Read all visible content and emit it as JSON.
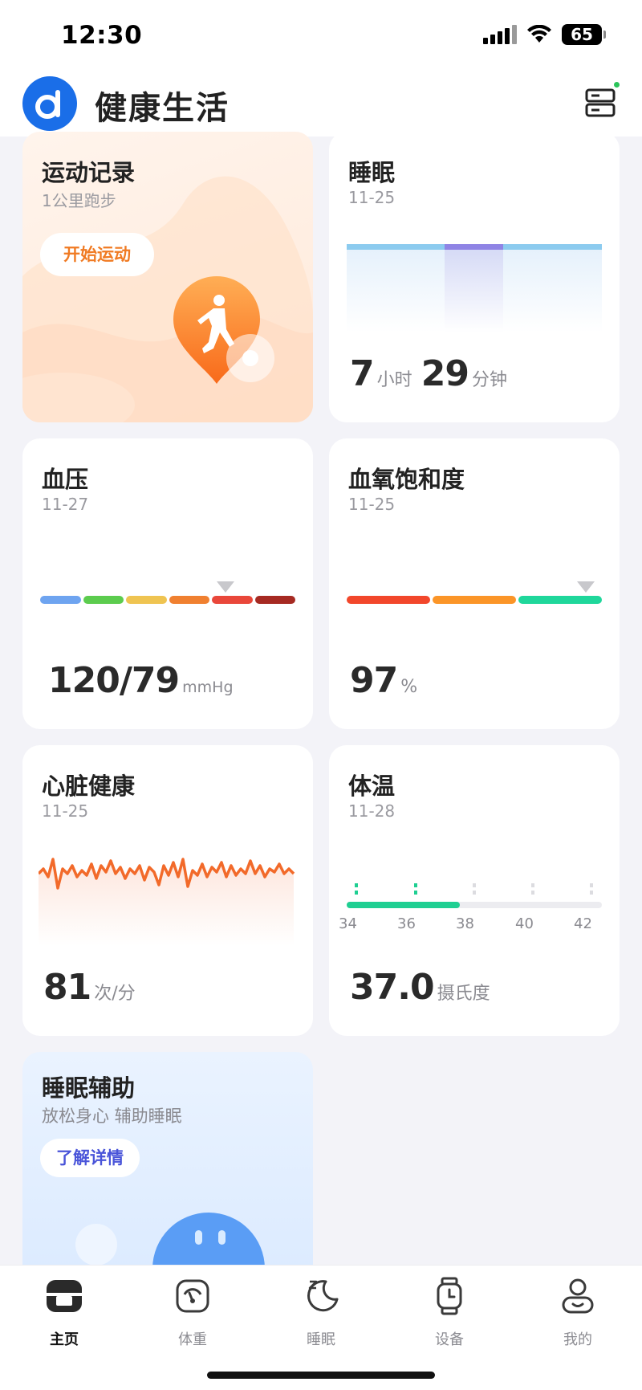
{
  "status_bar": {
    "time": "12:30",
    "battery": "65"
  },
  "header": {
    "title": "健康生活",
    "device_icon": "device-list-icon",
    "logo_icon": "app-logo-d"
  },
  "cards": {
    "exercise": {
      "title": "运动记录",
      "subtitle": "1公里跑步",
      "button": "开始运动",
      "icon": "runner-pin-icon"
    },
    "sleep": {
      "title": "睡眠",
      "date": "11-25",
      "hours": "7",
      "hours_unit": "小时",
      "minutes": "29",
      "minutes_unit": "分钟"
    },
    "blood_pressure": {
      "title": "血压",
      "date": "11-27",
      "value": "120/79",
      "unit": "mmHg",
      "scale_colors": [
        "#6ea4f0",
        "#5ccc4e",
        "#efc451",
        "#f08030",
        "#e9473a",
        "#a62a22"
      ],
      "level_index": 4
    },
    "spo2": {
      "title": "血氧饱和度",
      "date": "11-25",
      "value": "97",
      "unit": "%",
      "scale_colors": [
        "#f2472b",
        "#fb9528",
        "#1fd79b"
      ]
    },
    "heart": {
      "title": "心脏健康",
      "date": "11-25",
      "value": "81",
      "unit": "次/分",
      "line_color": "#f26a2a"
    },
    "temperature": {
      "title": "体温",
      "date": "11-28",
      "value": "37.0",
      "unit": "摄氏度",
      "ticks": [
        "34",
        "36",
        "38",
        "40",
        "42"
      ],
      "accent": "#1fcf92"
    },
    "sleep_aid": {
      "title": "睡眠辅助",
      "subtitle": "放松身心 辅助睡眠",
      "button": "了解详情"
    }
  },
  "tabs": [
    {
      "label": "主页",
      "icon": "home-icon",
      "active": true
    },
    {
      "label": "体重",
      "icon": "scale-icon",
      "active": false
    },
    {
      "label": "睡眠",
      "icon": "moon-icon",
      "active": false
    },
    {
      "label": "设备",
      "icon": "watch-icon",
      "active": false
    },
    {
      "label": "我的",
      "icon": "profile-icon",
      "active": false
    }
  ]
}
